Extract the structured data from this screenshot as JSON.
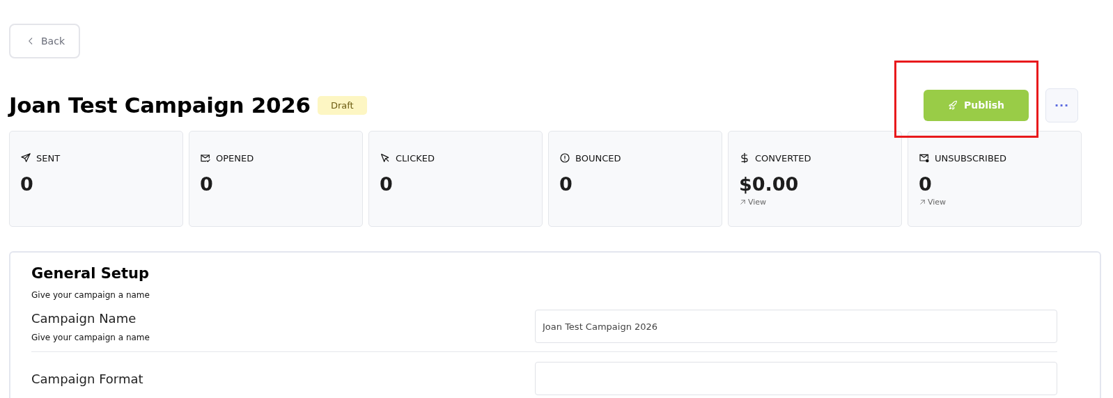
{
  "back_button": {
    "label": "Back"
  },
  "header": {
    "title": "Joan Test Campaign 2026",
    "status": "Draft",
    "publish_button": {
      "label": "Publish",
      "highlighted": true
    },
    "more_button": {
      "label": "···"
    }
  },
  "stats": [
    {
      "kind": "sent",
      "label": "SENT",
      "value": "0"
    },
    {
      "kind": "opened",
      "label": "OPENED",
      "value": "0"
    },
    {
      "kind": "clicked",
      "label": "CLICKED",
      "value": "0"
    },
    {
      "kind": "bounced",
      "label": "BOUNCED",
      "value": "0"
    },
    {
      "kind": "converted",
      "label": "CONVERTED",
      "value": "$0.00",
      "link": "View"
    },
    {
      "kind": "unsubscribed",
      "label": "UNSUBSCRIBED",
      "value": "0",
      "link": "View"
    }
  ],
  "general_setup": {
    "title": "General Setup",
    "subtitle": "Give your campaign a name",
    "fields": [
      {
        "label": "Campaign Name",
        "hint": "Give your campaign a name",
        "value": "Joan Test Campaign 2026"
      },
      {
        "label": "Campaign Format"
      }
    ]
  }
}
